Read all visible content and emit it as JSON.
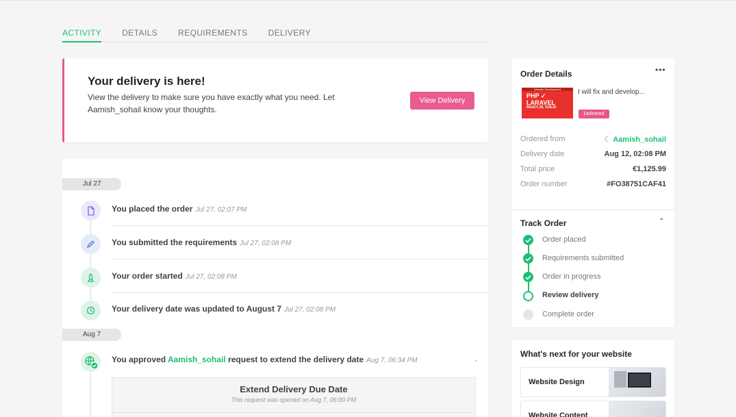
{
  "tabs": [
    {
      "label": "ACTIVITY",
      "active": true
    },
    {
      "label": "DETAILS",
      "active": false
    },
    {
      "label": "REQUIREMENTS",
      "active": false
    },
    {
      "label": "DELIVERY",
      "active": false
    }
  ],
  "banner": {
    "title": "Your delivery is here!",
    "text": "View the delivery to make sure you have exactly what you need. Let Aamish_sohail know your thoughts.",
    "button": "View Delivery"
  },
  "feed": {
    "dates": [
      "Jul 27",
      "Aug 7"
    ],
    "events": [
      {
        "text": "You placed the order",
        "time": "Jul 27, 02:07 PM",
        "icon": "file-icon"
      },
      {
        "text": "You submitted the requirements",
        "time": "Jul 27, 02:08 PM",
        "icon": "pencil-icon"
      },
      {
        "text": "Your order started",
        "time": "Jul 27, 02:08 PM",
        "icon": "rocket-icon"
      },
      {
        "text": "Your delivery date was updated to August 7",
        "time": "Jul 27, 02:08 PM",
        "icon": "clock-icon"
      },
      {
        "text_before": "You approved",
        "user": "Aamish_sohail",
        "text_after": "request to extend the delivery date",
        "time": "Aug 7, 06:34 PM",
        "icon": "globe-check-icon"
      }
    ],
    "extend_box": {
      "title": "Extend Delivery Due Date",
      "subtitle": "This request was opened on Aug 7, 06:00 PM"
    }
  },
  "order": {
    "title": "Order Details",
    "menu": "•••",
    "gig_title": "I will fix and develop...",
    "gig_thumb": {
      "top": "Website Development",
      "line1": "PHP",
      "line2": "LARAVEL",
      "line3": "REACT.JS, VUEJS"
    },
    "status_badge": "Delivered",
    "rows": [
      {
        "label": "Ordered from",
        "value": "Aamish_sohail"
      },
      {
        "label": "Delivery date",
        "value": "Aug 12, 02:08 PM"
      },
      {
        "label": "Total price",
        "value": "€1,125.99"
      },
      {
        "label": "Order number",
        "value": "#FO38751CAF41"
      }
    ]
  },
  "track": {
    "title": "Track Order",
    "steps": [
      {
        "label": "Order placed",
        "state": "done"
      },
      {
        "label": "Requirements submitted",
        "state": "done"
      },
      {
        "label": "Order in progress",
        "state": "done"
      },
      {
        "label": "Review delivery",
        "state": "current"
      },
      {
        "label": "Complete order",
        "state": "todo"
      }
    ]
  },
  "next": {
    "title": "What's next for your website",
    "cards": [
      "Website Design",
      "Website Content"
    ]
  },
  "colors": {
    "green": "#1dbf73",
    "pink": "#ea5b8f"
  }
}
